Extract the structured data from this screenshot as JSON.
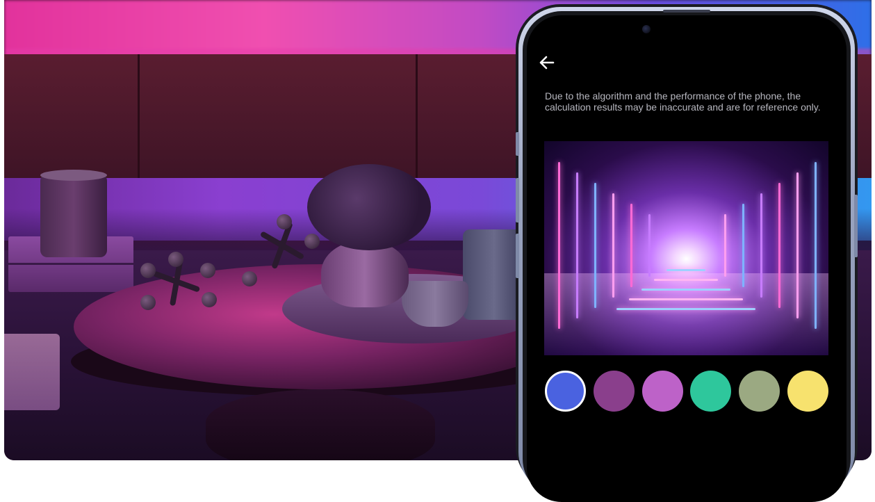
{
  "screen": {
    "back_icon": "arrow-left-icon",
    "notice": "Due to the algorithm and the performance of the phone, the calculation results may be inaccurate and are for reference only."
  },
  "palette": {
    "selected_index": 0,
    "colors": [
      "#4a62e0",
      "#8a3f8c",
      "#bd62c8",
      "#2ec79c",
      "#9ba982",
      "#f7e26e"
    ]
  }
}
